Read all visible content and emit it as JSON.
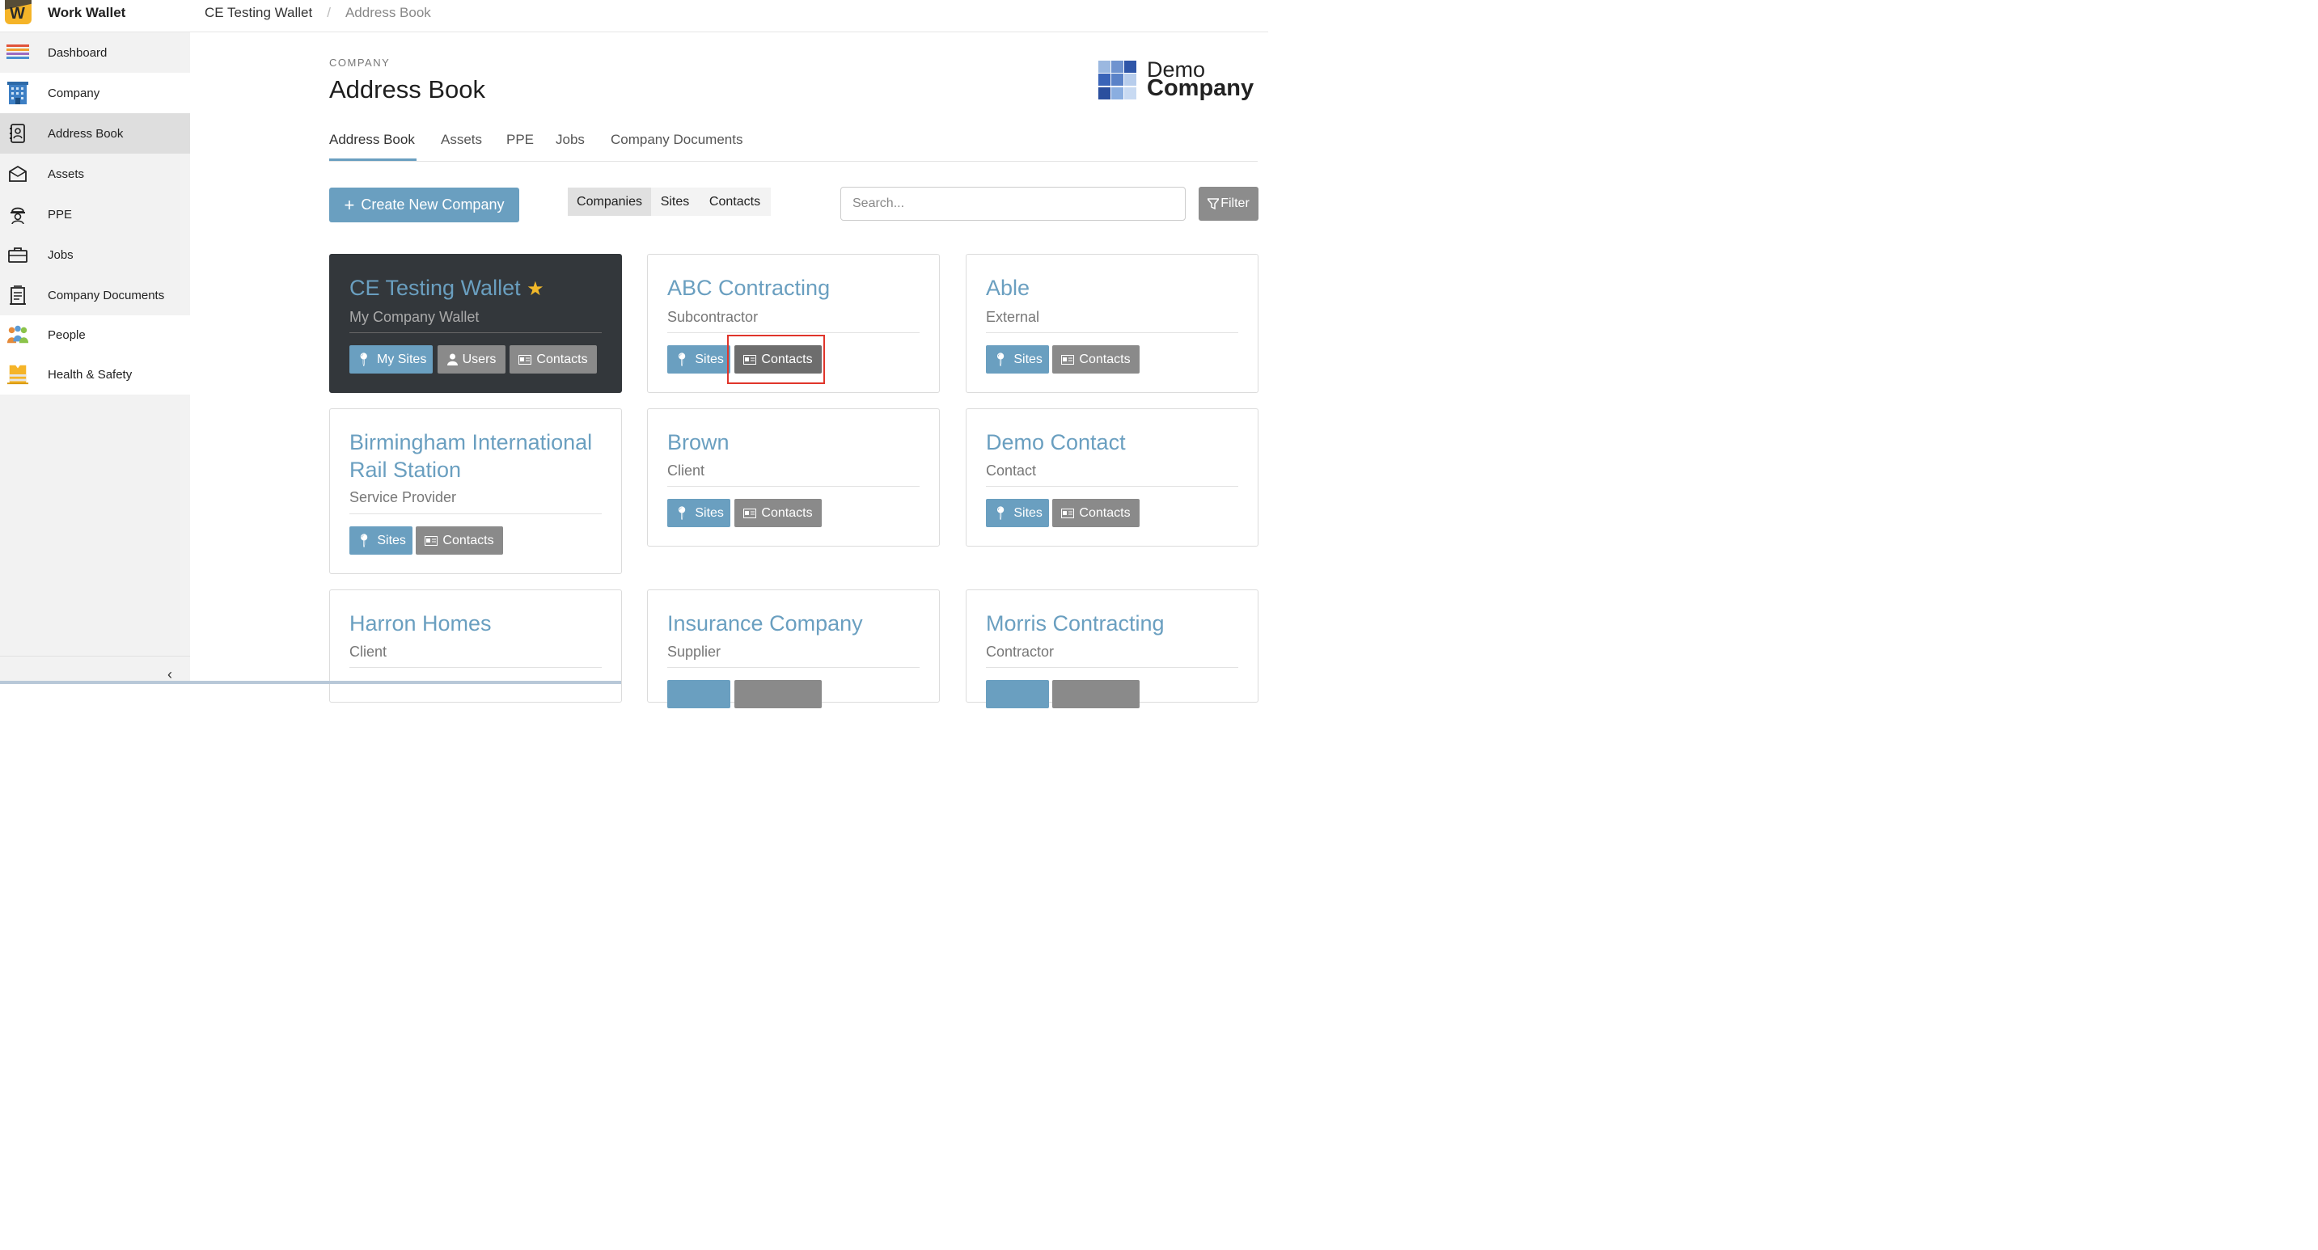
{
  "app": {
    "title": "Work Wallet",
    "logo_letter": "W"
  },
  "breadcrumb": {
    "company": "CE Testing Wallet",
    "current": "Address Book"
  },
  "sidebar": {
    "items": [
      {
        "label": "Dashboard",
        "icon": "dashboard-icon"
      },
      {
        "label": "Company",
        "icon": "building-icon"
      },
      {
        "label": "Address Book",
        "icon": "address-book-icon"
      },
      {
        "label": "Assets",
        "icon": "assets-icon"
      },
      {
        "label": "PPE",
        "icon": "ppe-icon"
      },
      {
        "label": "Jobs",
        "icon": "briefcase-icon"
      },
      {
        "label": "Company Documents",
        "icon": "documents-icon"
      },
      {
        "label": "People",
        "icon": "people-icon"
      },
      {
        "label": "Health & Safety",
        "icon": "health-safety-icon"
      }
    ],
    "collapse_glyph": "‹"
  },
  "header": {
    "section": "COMPANY",
    "title": "Address Book",
    "brand_line1": "Demo",
    "brand_line2": "Company"
  },
  "tabs": [
    "Address Book",
    "Assets",
    "PPE",
    "Jobs",
    "Company Documents"
  ],
  "toolbar": {
    "create_label": "Create New Company",
    "segments": [
      "Companies",
      "Sites",
      "Contacts"
    ],
    "search_placeholder": "Search...",
    "filter_label": "Filter"
  },
  "cards": [
    {
      "name": "CE Testing Wallet",
      "type": "My Company Wallet",
      "buttons": [
        "My Sites",
        "Users",
        "Contacts"
      ]
    },
    {
      "name": "ABC Contracting",
      "type": "Subcontractor",
      "buttons": [
        "Sites",
        "Contacts"
      ]
    },
    {
      "name": "Able",
      "type": "External",
      "buttons": [
        "Sites",
        "Contacts"
      ]
    },
    {
      "name_line1": "Birmingham International",
      "name_line2": "Rail Station",
      "type": "Service Provider",
      "buttons": [
        "Sites",
        "Contacts"
      ]
    },
    {
      "name": "Brown",
      "type": "Client",
      "buttons": [
        "Sites",
        "Contacts"
      ]
    },
    {
      "name": "Demo Contact",
      "type": "Contact",
      "buttons": [
        "Sites",
        "Contacts"
      ]
    },
    {
      "name": "Harron Homes",
      "type": "Client"
    },
    {
      "name": "Insurance Company",
      "type": "Supplier"
    },
    {
      "name": "Morris Contracting",
      "type": "Contractor"
    }
  ],
  "colors": {
    "accent": "#6a9fc0",
    "dark_card": "#33373b",
    "highlight": "#e0352b",
    "star": "#f2b92a"
  }
}
